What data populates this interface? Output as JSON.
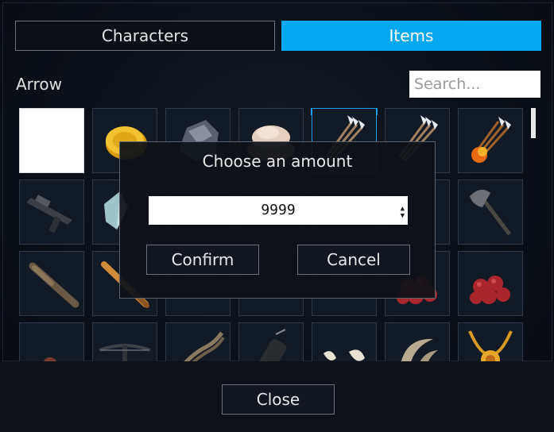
{
  "tabs": [
    {
      "label": "Characters",
      "active": false
    },
    {
      "label": "Items",
      "active": true
    }
  ],
  "category_title": "Arrow",
  "search": {
    "placeholder": "Search...",
    "value": ""
  },
  "items": [
    {
      "icon": "empty-slot"
    },
    {
      "icon": "gold-coin-icon"
    },
    {
      "icon": "ore-rock-icon"
    },
    {
      "icon": "stone-pile-icon"
    },
    {
      "icon": "arrow-bundle-icon",
      "selected": true
    },
    {
      "icon": "arrow-bundle-icon"
    },
    {
      "icon": "fire-arrow-bundle-icon"
    },
    {
      "icon": "rifle-icon"
    },
    {
      "icon": "crystal-icon"
    },
    {
      "icon": "unknown-item-icon"
    },
    {
      "icon": "unknown-item-icon"
    },
    {
      "icon": "unknown-item-icon"
    },
    {
      "icon": "unknown-item-icon"
    },
    {
      "icon": "axe-icon"
    },
    {
      "icon": "wooden-club-icon"
    },
    {
      "icon": "baseball-bat-icon"
    },
    {
      "icon": "unknown-item-icon"
    },
    {
      "icon": "unknown-item-icon"
    },
    {
      "icon": "unknown-item-icon"
    },
    {
      "icon": "berries-icon"
    },
    {
      "icon": "berries-icon"
    },
    {
      "icon": "nuts-icon"
    },
    {
      "icon": "crossbow-icon"
    },
    {
      "icon": "rope-icon"
    },
    {
      "icon": "quiver-icon"
    },
    {
      "icon": "fangs-icon"
    },
    {
      "icon": "claws-icon"
    },
    {
      "icon": "gold-necklace-icon"
    }
  ],
  "modal": {
    "title": "Choose an amount",
    "amount": "9999",
    "confirm_label": "Confirm",
    "cancel_label": "Cancel"
  },
  "footer": {
    "close_label": "Close"
  },
  "colors": {
    "accent": "#06a9f0",
    "selection": "#1e9ef0",
    "background": "#0a0e16"
  }
}
